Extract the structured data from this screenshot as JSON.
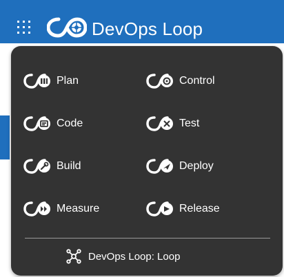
{
  "header": {
    "app_title": "DevOps Loop",
    "menu_icon": "waffle-grid-icon",
    "logo_icon": "devops-loop-logo-icon"
  },
  "menu": {
    "items": [
      {
        "label": "Plan",
        "icon": "plan-icon"
      },
      {
        "label": "Control",
        "icon": "control-icon"
      },
      {
        "label": "Code",
        "icon": "code-icon"
      },
      {
        "label": "Test",
        "icon": "test-icon"
      },
      {
        "label": "Build",
        "icon": "build-icon"
      },
      {
        "label": "Deploy",
        "icon": "deploy-icon"
      },
      {
        "label": "Measure",
        "icon": "measure-icon"
      },
      {
        "label": "Release",
        "icon": "release-icon"
      }
    ],
    "footer": {
      "label": "DevOps Loop: Loop",
      "icon": "network-hub-icon"
    }
  },
  "colors": {
    "header_bg": "#1f6fbd",
    "menu_bg": "#333333",
    "text": "#ffffff"
  }
}
